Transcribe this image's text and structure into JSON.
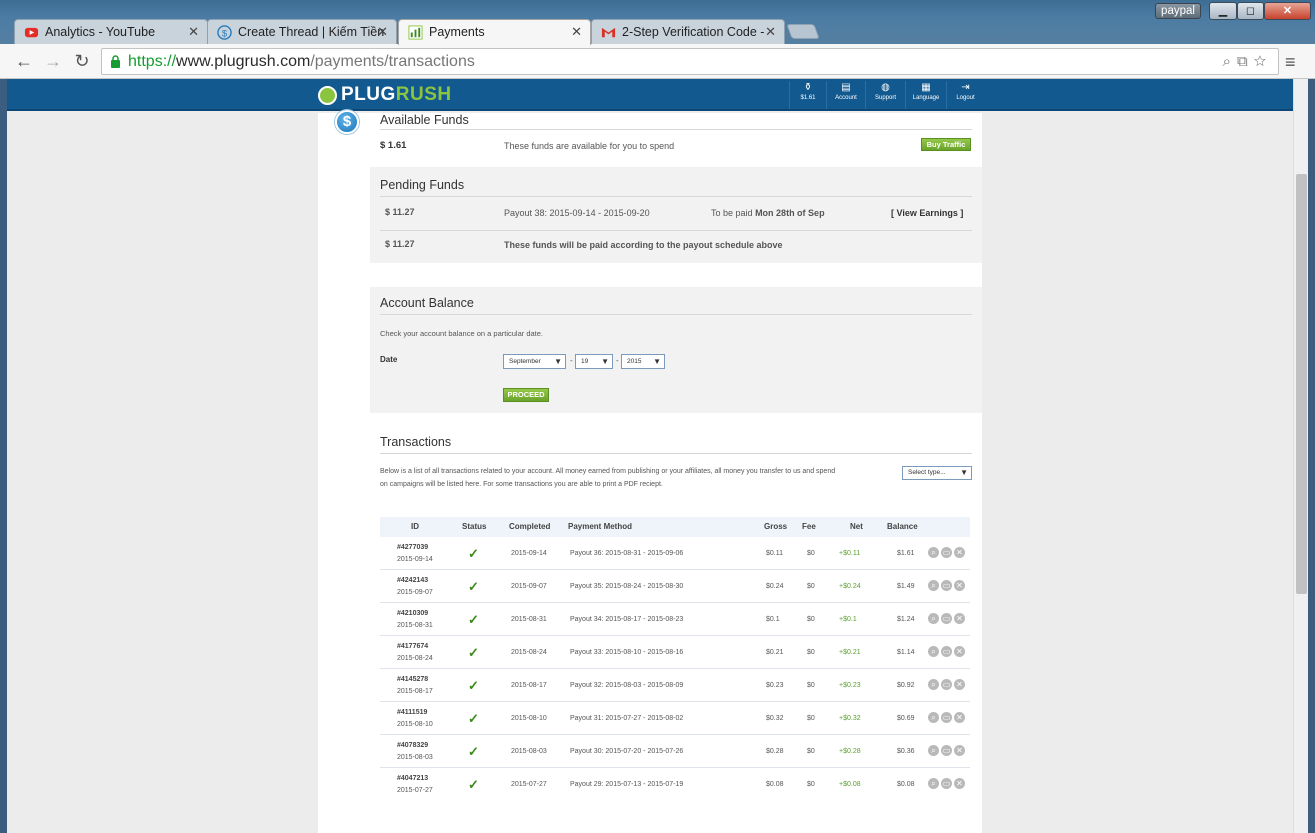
{
  "browser": {
    "tabs": [
      {
        "label": "Analytics - YouTube",
        "icon": "youtube-icon"
      },
      {
        "label": "Create Thread | Kiếm Tiền",
        "icon": "forum-icon"
      },
      {
        "label": "Payments",
        "icon": "bar-chart-icon"
      },
      {
        "label": "2-Step Verification Code -",
        "icon": "gmail-icon"
      }
    ],
    "user_badge": "paypal",
    "url_scheme": "https://",
    "url_host": "www.plugrush.com",
    "url_path": "/payments/transactions"
  },
  "header": {
    "logo_plug": "PLUG",
    "logo_rush": "RUSH",
    "nav": [
      {
        "label": "$1.61",
        "icon": "money-bag-icon"
      },
      {
        "label": "Account",
        "icon": "account-icon"
      },
      {
        "label": "Support",
        "icon": "chat-icon"
      },
      {
        "label": "Language",
        "icon": "flag-icon"
      },
      {
        "label": "Logout",
        "icon": "logout-icon"
      }
    ]
  },
  "available": {
    "title": "Available Funds",
    "amount": "$ 1.61",
    "desc": "These funds are available for you to spend",
    "button": "Buy Traffic"
  },
  "pending": {
    "title": "Pending Funds",
    "row_amount": "$ 11.27",
    "payout": "Payout 38: 2015-09-14 - 2015-09-20",
    "to_be_paid": "To be paid",
    "paid_date": "Mon 28th of Sep",
    "view": "[ View Earnings ]",
    "total_amount": "$ 11.27",
    "total_desc": "These funds will be paid according to the payout schedule above"
  },
  "balance": {
    "title": "Account Balance",
    "desc": "Check your account balance on a particular date.",
    "date_label": "Date",
    "month": "September",
    "day": "19",
    "year": "2015",
    "sep": "-",
    "button": "PROCEED"
  },
  "transactions": {
    "title": "Transactions",
    "desc1": "Below is a list of all transactions related to your account. All money earned from publishing or your affiliates, all money you transfer to us and spend",
    "desc2": "on campaigns will be listed here. For some transactions you are able to print a PDF reciept.",
    "filter": "Select type...",
    "headers": {
      "id": "ID",
      "status": "Status",
      "completed": "Completed",
      "method": "Payment Method",
      "gross": "Gross",
      "fee": "Fee",
      "net": "Net",
      "balance": "Balance"
    },
    "rows": [
      {
        "id": "#4277039",
        "date": "2015-09-14",
        "completed": "2015-09-14",
        "method": "Payout 36: 2015-08-31 - 2015-09-06",
        "gross": "$0.11",
        "fee": "$0",
        "net": "+$0.11",
        "balance": "$1.61"
      },
      {
        "id": "#4242143",
        "date": "2015-09-07",
        "completed": "2015-09-07",
        "method": "Payout 35: 2015-08-24 - 2015-08-30",
        "gross": "$0.24",
        "fee": "$0",
        "net": "+$0.24",
        "balance": "$1.49"
      },
      {
        "id": "#4210309",
        "date": "2015-08-31",
        "completed": "2015-08-31",
        "method": "Payout 34: 2015-08-17 - 2015-08-23",
        "gross": "$0.1",
        "fee": "$0",
        "net": "+$0.1",
        "balance": "$1.24"
      },
      {
        "id": "#4177674",
        "date": "2015-08-24",
        "completed": "2015-08-24",
        "method": "Payout 33: 2015-08-10 - 2015-08-16",
        "gross": "$0.21",
        "fee": "$0",
        "net": "+$0.21",
        "balance": "$1.14"
      },
      {
        "id": "#4145278",
        "date": "2015-08-17",
        "completed": "2015-08-17",
        "method": "Payout 32: 2015-08-03 - 2015-08-09",
        "gross": "$0.23",
        "fee": "$0",
        "net": "+$0.23",
        "balance": "$0.92"
      },
      {
        "id": "#4111519",
        "date": "2015-08-10",
        "completed": "2015-08-10",
        "method": "Payout 31: 2015-07-27 - 2015-08-02",
        "gross": "$0.32",
        "fee": "$0",
        "net": "+$0.32",
        "balance": "$0.69"
      },
      {
        "id": "#4078329",
        "date": "2015-08-03",
        "completed": "2015-08-03",
        "method": "Payout 30: 2015-07-20 - 2015-07-26",
        "gross": "$0.28",
        "fee": "$0",
        "net": "+$0.28",
        "balance": "$0.36"
      },
      {
        "id": "#4047213",
        "date": "2015-07-27",
        "completed": "2015-07-27",
        "method": "Payout 29: 2015-07-13 - 2015-07-19",
        "gross": "$0.08",
        "fee": "$0",
        "net": "+$0.08",
        "balance": "$0.08"
      }
    ]
  }
}
